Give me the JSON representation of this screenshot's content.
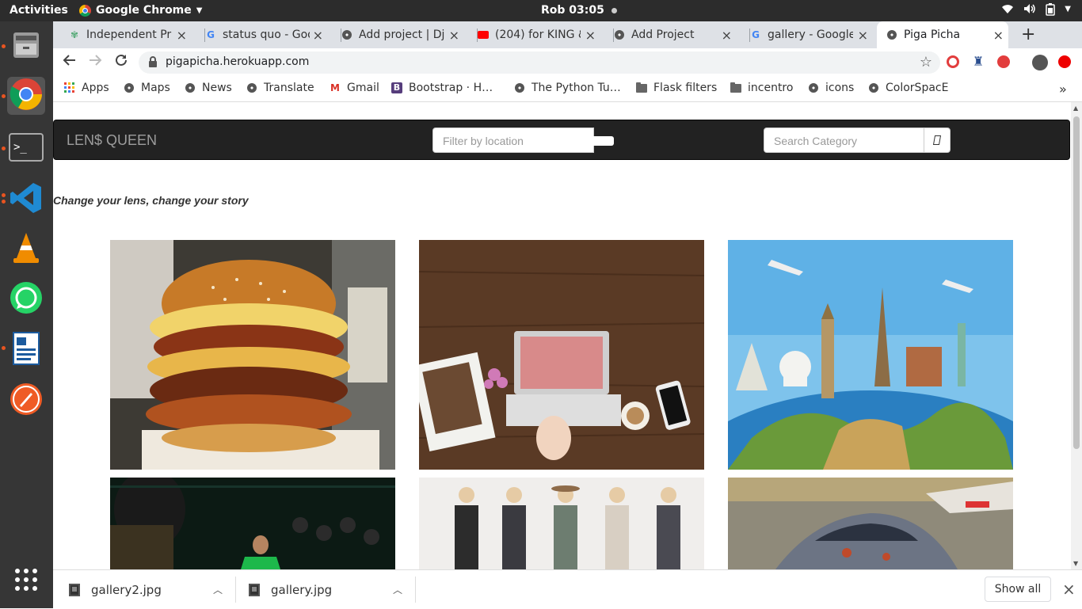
{
  "system": {
    "activities": "Activities",
    "app_name": "Google Chrome",
    "clock": "Rob 03:05"
  },
  "tabs": [
    {
      "title": "Independent Pr",
      "icon": "plant-icon"
    },
    {
      "title": "status quo - Goo",
      "icon": "google-icon"
    },
    {
      "title": "Add project | Dj",
      "icon": "globe-icon"
    },
    {
      "title": "(204) for KING &",
      "icon": "youtube-icon"
    },
    {
      "title": "Add Project",
      "icon": "globe-icon"
    },
    {
      "title": "gallery - Google",
      "icon": "google-icon"
    },
    {
      "title": "Piga Picha",
      "icon": "globe-icon",
      "active": true
    }
  ],
  "address_bar": {
    "url": "pigapicha.herokuapp.com"
  },
  "bookmarks": [
    {
      "label": "Apps",
      "icon": "apps-grid-icon"
    },
    {
      "label": "Maps",
      "icon": "globe-icon"
    },
    {
      "label": "News",
      "icon": "globe-icon"
    },
    {
      "label": "Translate",
      "icon": "globe-icon"
    },
    {
      "label": "Gmail",
      "icon": "gmail-icon"
    },
    {
      "label": "Bootstrap · H…",
      "icon": "bootstrap-icon"
    },
    {
      "label": "The Python Tu…",
      "icon": "globe-icon"
    },
    {
      "label": "Flask filters",
      "icon": "folder-icon"
    },
    {
      "label": "incentro",
      "icon": "folder-icon"
    },
    {
      "label": "icons",
      "icon": "globe-icon"
    },
    {
      "label": "ColorSpacE",
      "icon": "globe-icon"
    }
  ],
  "page": {
    "brand": "LEN$ QUEEN",
    "location_placeholder": "Filter by location",
    "category_placeholder": "Search Category",
    "tagline": "Change your lens, change your story",
    "images": [
      {
        "subject": "burger"
      },
      {
        "subject": "laptop-desk"
      },
      {
        "subject": "world-travel"
      },
      {
        "subject": "runway-fashion"
      },
      {
        "subject": "women-fashion"
      },
      {
        "subject": "race-car"
      }
    ]
  },
  "downloads": {
    "items": [
      "gallery2.jpg",
      "gallery.jpg"
    ],
    "show_all": "Show all"
  },
  "colors": {
    "navbar_bg": "#222222",
    "brand_text": "#9d9d9d",
    "tab_strip": "#dee1e6",
    "dock_bg": "#363636",
    "topbar_bg": "#2c2c2c"
  }
}
